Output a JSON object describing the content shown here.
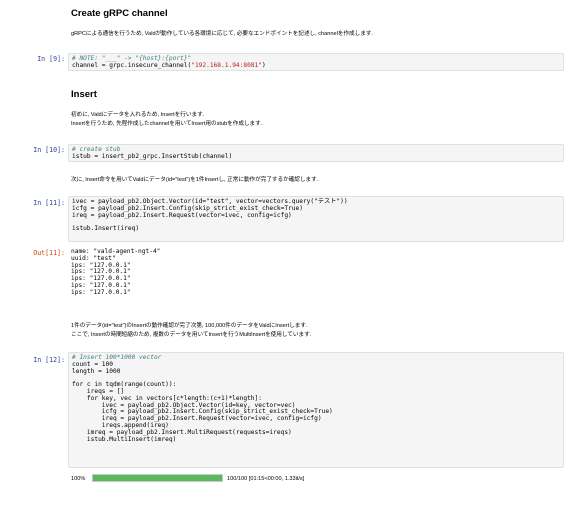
{
  "sections": {
    "create_channel": {
      "heading": "Create gRPC channel",
      "desc": "gRPCによる通信を行うため, Valdが動作している各環境に応じて, 必要なエンドポイントを記述し, channelを作成します."
    },
    "insert": {
      "heading": "Insert",
      "desc_line1": "初めに, Valdにデータを入れるため, Insertを行います.",
      "desc_line2": "Insertを行うため, 先程作成したchannelを用いてInsert用のstubを作成します."
    }
  },
  "cells": {
    "in9": {
      "prompt": "In [9]:",
      "line1": "# NOTE: \"___\" -> \"{host}:{port}\"",
      "line2_a": "channel = grpc.insecure_channel(",
      "line2_s": "\"192.168.1.94:8081\"",
      "line2_b": ")"
    },
    "in10": {
      "prompt": "In [10]:",
      "line1": "# create stub",
      "line2": "istub = insert_pb2_grpc.InsertStub(channel)"
    },
    "text_between_10_11": "次に, Insert命令を用いてValdにデータ(id=\"test\")を1件Insertし, 正常に動作が完了するか確認します.",
    "in11": {
      "prompt": "In [11]:",
      "line1": "ivec = payload_pb2.Object.Vector(id=\"test\", vector=vectors.query(\"テスト\"))",
      "line2": "icfg = payload_pb2.Insert.Config(skip_strict_exist_check=True)",
      "line3": "ireq = payload_pb2.Insert.Request(vector=ivec, config=icfg)",
      "line4": "istub.Insert(ireq)"
    },
    "out11": {
      "prompt": "Out[11]:",
      "text": "name: \"vald-agent-ngt-4\"\nuuid: \"test\"\nips: \"127.0.0.1\"\nips: \"127.0.0.1\"\nips: \"127.0.0.1\"\nips: \"127.0.0.1\"\nips: \"127.0.0.1\""
    },
    "text_after_out11_line1": "1件のデータ(id=\"test\")のInsertの動作確認が完了次第, 100,000件のデータをValdにInsertします.",
    "text_after_out11_line2": "ここで, Insertの時間短縮のため, 複数のデータを用いてInsertを行うMultiInsertを使用しています.",
    "in12": {
      "prompt": "In [12]:",
      "comment": "# Insert 100*1000 vector",
      "count": "count = 100",
      "length": "length = 1000",
      "for1": "for c in tqdm(range(count)):",
      "ireqs": "    ireqs = []",
      "for2": "    for key, vec in vectors[c*length:(c+1)*length]:",
      "l1": "        ivec = payload_pb2.Object.Vector(id=key, vector=vec)",
      "l2": "        icfg = payload_pb2.Insert.Config(skip_strict_exist_check=True)",
      "l3": "        ireq = payload_pb2.Insert.Request(vector=ivec, config=icfg)",
      "l4": "        ireqs.append(ireq)",
      "l5": "    imreq = payload_pb2.Insert.MultiRequest(requests=ireqs)",
      "l6": "    istub.MultiInsert(imreq)"
    },
    "progress": {
      "percent": "100%",
      "fraction": 1.0,
      "status": "100/100 [01:15<00:00, 1.33it/s]",
      "bar_color": "#5cb85c"
    }
  }
}
